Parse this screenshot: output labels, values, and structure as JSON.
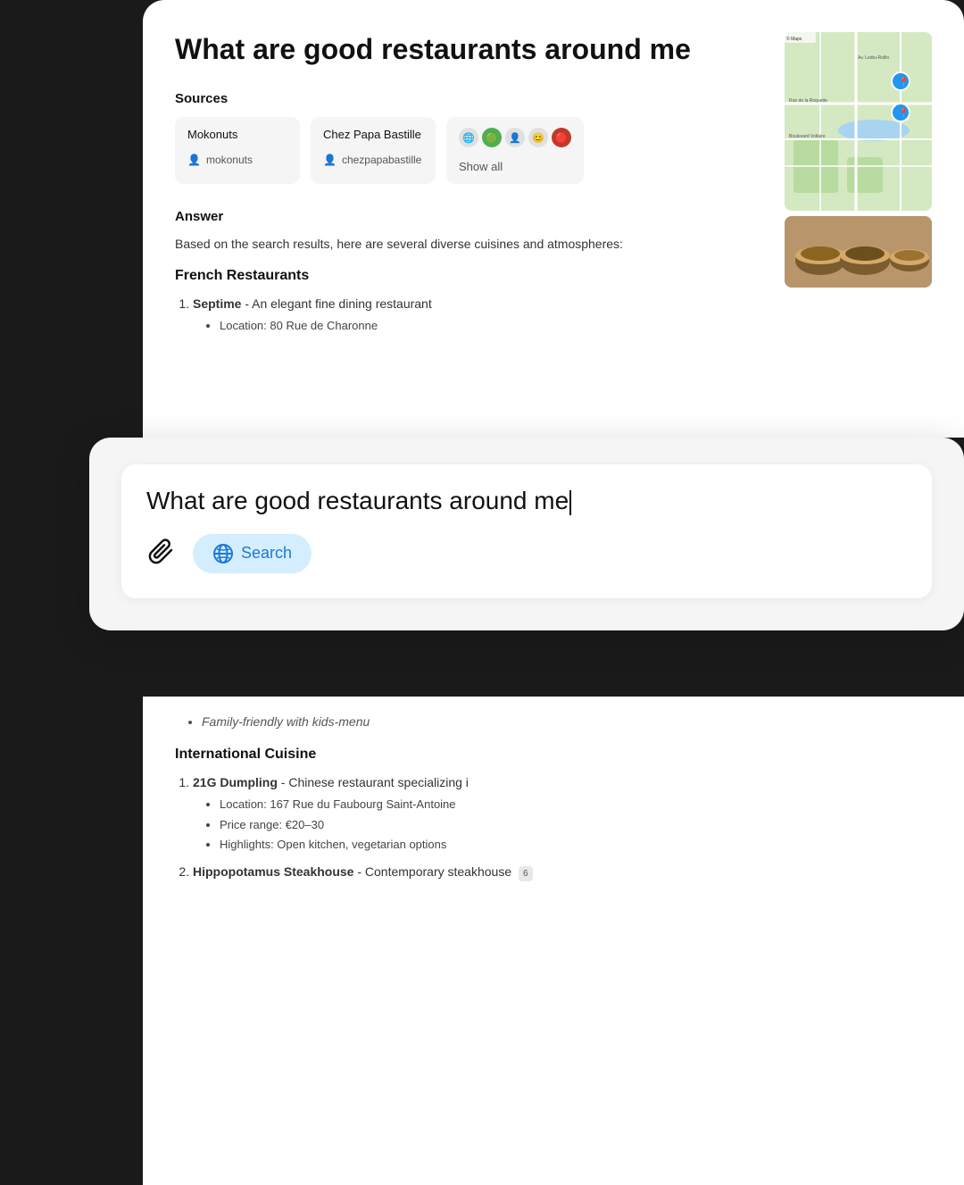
{
  "page": {
    "title": "What are good restaurants around me",
    "bg_color": "#111111"
  },
  "top_card": {
    "title": "What are good restaurants around me",
    "sources_label": "Sources",
    "sources": [
      {
        "name": "Mokonuts",
        "username": "mokonuts",
        "has_icon": true
      },
      {
        "name": "Chez Papa Bastille",
        "username": "chezpapabastille",
        "has_icon": true
      },
      {
        "name": "show_all",
        "label": "Show all",
        "has_icons": true
      }
    ],
    "answer_label": "Answer",
    "answer_text": "Based on the search results, here are several diverse cuisines and atmospheres:",
    "french_section": {
      "title": "French Restaurants",
      "items": [
        {
          "name": "Septime",
          "description": "An elegant fine dining restaurant",
          "details": [
            "Location: 80 Rue de Charonne"
          ]
        }
      ]
    }
  },
  "search_card": {
    "query": "What are good restaurants around me",
    "cursor_visible": true,
    "attach_label": "Attach",
    "search_label": "Search"
  },
  "bottom_card": {
    "truncated": "Family-friendly with kids-menu",
    "international_section": {
      "title": "International Cuisine",
      "items": [
        {
          "name": "21G Dumpling",
          "description": "Chinese restaurant specializing i",
          "badge": null,
          "details": [
            "Location: 167 Rue du Faubourg Saint-Antoine",
            "Price range: €20–30",
            "Highlights: Open kitchen, vegetarian options"
          ]
        },
        {
          "name": "Hippopotamus Steakhouse",
          "description": "Contemporary steakhouse",
          "badge": "6",
          "details": []
        }
      ]
    }
  }
}
